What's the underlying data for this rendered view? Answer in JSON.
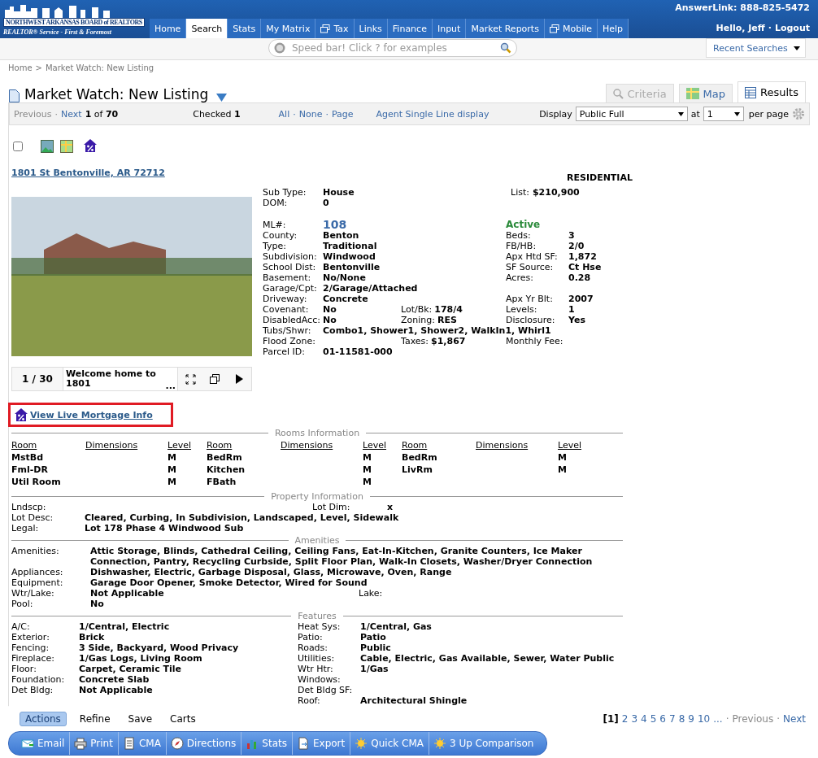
{
  "header": {
    "logo": {
      "board_name": "NORTHWEST ARKANSAS BOARD of REALTORS",
      "tagline": "REALTOR® Service - First & Foremost"
    },
    "nav_tabs": [
      {
        "label": "Home",
        "selected": false,
        "kind": "plain"
      },
      {
        "label": "Search",
        "selected": true,
        "kind": "plain"
      },
      {
        "label": "Stats",
        "selected": false,
        "kind": "plain"
      },
      {
        "label": "My Matrix",
        "selected": false,
        "kind": "plain"
      },
      {
        "label": "Tax",
        "selected": false,
        "kind": "window"
      },
      {
        "label": "Links",
        "selected": false,
        "kind": "plain"
      },
      {
        "label": "Finance",
        "selected": false,
        "kind": "plain"
      },
      {
        "label": "Input",
        "selected": false,
        "kind": "plain"
      },
      {
        "label": "Market Reports",
        "selected": false,
        "kind": "plain"
      },
      {
        "label": "Mobile",
        "selected": false,
        "kind": "window"
      },
      {
        "label": "Help",
        "selected": false,
        "kind": "plain"
      }
    ],
    "answerlink": "AnswerLink: 888-825-5472",
    "greeting": "Hello, Jeff",
    "separator": "·",
    "logout": "Logout"
  },
  "speed_bar": {
    "placeholder": "Speed bar! Click ? for examples"
  },
  "recent_searches": "Recent Searches",
  "breadcrumb": {
    "items": [
      "Home",
      "Market Watch: New Listing"
    ],
    "separator": ">"
  },
  "page_title": "Market Watch: New Listing",
  "view_tabs": [
    {
      "label": "Criteria",
      "selected": false,
      "disabled": true
    },
    {
      "label": "Map",
      "selected": false,
      "disabled": false
    },
    {
      "label": "Results",
      "selected": true,
      "disabled": false
    }
  ],
  "toolbar": {
    "previous": {
      "label": "Previous",
      "disabled": true
    },
    "next": {
      "label": "Next",
      "disabled": false
    },
    "separator": "·",
    "position": "**1** of **70**",
    "checked": "Checked **1**",
    "select_links": [
      "All",
      "None",
      "Page"
    ],
    "agent_link": "Agent Single Line display",
    "display_label": "Display",
    "display_value": "Public Full",
    "at_label": "at",
    "page_value": "1",
    "per_page_label": "per page"
  },
  "select_all": {
    "checked": false
  },
  "listing": {
    "address": "1801 St Bentonville, AR 72712",
    "category": "RESIDENTIAL",
    "top_rows": [
      {
        "label": "Sub Type:",
        "value": "House"
      },
      {
        "label": "DOM:",
        "value": "0"
      }
    ],
    "list_price": {
      "label": "List:",
      "value": "$210,900"
    },
    "mls": {
      "label": "ML#:",
      "value": "108"
    },
    "status": "Active",
    "rows": [
      {
        "left": {
          "label": "County:",
          "value": "Benton"
        },
        "right": {
          "label": "Beds:",
          "value": "3"
        }
      },
      {
        "left": {
          "label": "Type:",
          "value": "Traditional"
        },
        "right": {
          "label": "FB/HB:",
          "value": "2/0"
        }
      },
      {
        "left": {
          "label": "Subdivision:",
          "value": "Windwood"
        },
        "right": {
          "label": "Apx Htd SF:",
          "value": "1,872"
        }
      },
      {
        "left": {
          "label": "School Dist:",
          "value": "Bentonville"
        },
        "right": {
          "label": "SF Source:",
          "value": "Ct Hse"
        }
      },
      {
        "left": {
          "label": "Basement:",
          "value": "No/None"
        },
        "right": {
          "label": "Acres:",
          "value": "0.28"
        }
      },
      {
        "left": {
          "label": "Garage/Cpt:",
          "value": "2/Garage/Attached"
        }
      },
      {
        "left": {
          "label": "Driveway:",
          "value": "Concrete"
        },
        "right": {
          "label": "Apx Yr Blt:",
          "value": "2007"
        }
      },
      {
        "left": {
          "label": "Covenant:",
          "value": "No"
        },
        "middle": {
          "label": "Lot/Bk:",
          "value": "178/4"
        },
        "right": {
          "label": "Levels:",
          "value": "1"
        }
      },
      {
        "left": {
          "label": "DisabledAcc:",
          "value": "No"
        },
        "middle": {
          "label": "Zoning:",
          "value": "RES"
        },
        "right": {
          "label": "Disclosure:",
          "value": "Yes"
        }
      },
      {
        "left": {
          "label": "Tubs/Shwr:",
          "value": "Combo1, Shower1, Shower2, WalkIn1, Whirl1"
        }
      },
      {
        "left": {
          "label": "Flood Zone:"
        },
        "middle": {
          "label": "Taxes:",
          "value": "$1,867"
        },
        "right": {
          "label": "Monthly Fee:"
        }
      },
      {
        "left": {
          "label": "Parcel ID:",
          "value": "01-11581-000"
        }
      }
    ],
    "photo_viewer": {
      "counter": "1 / 30",
      "caption": "Welcome home to 1801",
      "more": "..."
    }
  },
  "mortgage_link": "View Live Mortgage Info",
  "rooms": {
    "title": "Rooms Information",
    "headers": [
      "Room",
      "Dimensions",
      "Level",
      "Room",
      "Dimensions",
      "Level",
      "Room",
      "Dimensions",
      "Level"
    ],
    "items": [
      {
        "room": "MstBd",
        "level": "M"
      },
      {
        "room": "BedRm",
        "level": "M"
      },
      {
        "room": "BedRm",
        "level": "M"
      },
      {
        "room": "Fml-DR",
        "level": "M"
      },
      {
        "room": "Kitchen",
        "level": "M"
      },
      {
        "room": "LivRm",
        "level": "M"
      },
      {
        "room": "Util Room",
        "level": "M"
      },
      {
        "room": "FBath",
        "level": "M"
      }
    ]
  },
  "sections": [
    {
      "title": "Property Information",
      "rows": [
        {
          "label": "Lndscp:",
          "right": {
            "label": "Lot Dim:",
            "value": "x"
          }
        },
        {
          "label": "Lot Desc:",
          "value": "Cleared, Curbing, In Subdivision, Landscaped, Level, Sidewalk"
        },
        {
          "label": "Legal:",
          "value": "Lot 178 Phase 4 Windwood Sub"
        }
      ]
    },
    {
      "title": "Amenities",
      "rows": [
        {
          "label": "Amenities:",
          "value": "Attic Storage, Blinds, Cathedral Ceiling, Ceiling Fans, Eat-In-Kitchen, Granite Counters, Ice Maker Connection, Pantry, Recycling Curbside, Split Floor Plan, Walk-In Closets, Washer/Dryer Connection"
        },
        {
          "label": "Appliances:",
          "value": "Dishwasher, Electric, Garbage Disposal, Glass, Microwave, Oven, Range"
        },
        {
          "label": "Equipment:",
          "value": "Garage Door Opener, Smoke Detector, Wired for Sound"
        },
        {
          "label": "Wtr/Lake:",
          "value": "Not Applicable",
          "right": {
            "label": "Lake:"
          }
        },
        {
          "label": "Pool:",
          "value": "No"
        }
      ]
    },
    {
      "title": "Features",
      "rows": [
        {
          "label": "A/C:",
          "value": "1/Central, Electric",
          "right": {
            "label": "Heat Sys:",
            "value": "1/Central, Gas"
          }
        },
        {
          "label": "Exterior:",
          "value": "Brick",
          "right": {
            "label": "Patio:",
            "value": "Patio"
          }
        },
        {
          "label": "Fencing:",
          "value": "3 Side, Backyard, Wood Privacy",
          "right": {
            "label": "Roads:",
            "value": "Public"
          }
        },
        {
          "label": "Fireplace:",
          "value": "1/Gas Logs, Living Room",
          "right": {
            "label": "Utilities:",
            "value": "Cable, Electric, Gas Available, Sewer, Water Public"
          }
        },
        {
          "label": "Floor:",
          "value": "Carpet, Ceramic Tile",
          "right": {
            "label": "Wtr Htr:",
            "value": "1/Gas"
          }
        },
        {
          "label": "Foundation:",
          "value": "Concrete Slab",
          "right": {
            "label": "Windows:"
          }
        },
        {
          "label": "Det Bldg:",
          "value": "Not Applicable",
          "right": {
            "label": "Det Bldg SF:"
          }
        },
        {
          "right": {
            "label": "Roof:",
            "value": "Architectural Shingle"
          }
        }
      ]
    }
  ],
  "footer": {
    "tabs": [
      {
        "label": "Actions",
        "selected": true
      },
      {
        "label": "Refine",
        "selected": false
      },
      {
        "label": "Save",
        "selected": false
      },
      {
        "label": "Carts",
        "selected": false
      }
    ],
    "pages": [
      {
        "label": "[1]",
        "selected": true
      },
      {
        "label": "2",
        "selected": false
      },
      {
        "label": "3",
        "selected": false
      },
      {
        "label": "4",
        "selected": false
      },
      {
        "label": "5",
        "selected": false
      },
      {
        "label": "6",
        "selected": false
      },
      {
        "label": "7",
        "selected": false
      },
      {
        "label": "8",
        "selected": false
      },
      {
        "label": "9",
        "selected": false
      },
      {
        "label": "10",
        "selected": false
      }
    ],
    "more_pages": "...",
    "separator": "·",
    "previous": "Previous",
    "next": "Next",
    "actions": [
      "Email",
      "Print",
      "CMA",
      "Directions",
      "Stats",
      "Export",
      "Quick CMA",
      "3 Up Comparison"
    ]
  }
}
